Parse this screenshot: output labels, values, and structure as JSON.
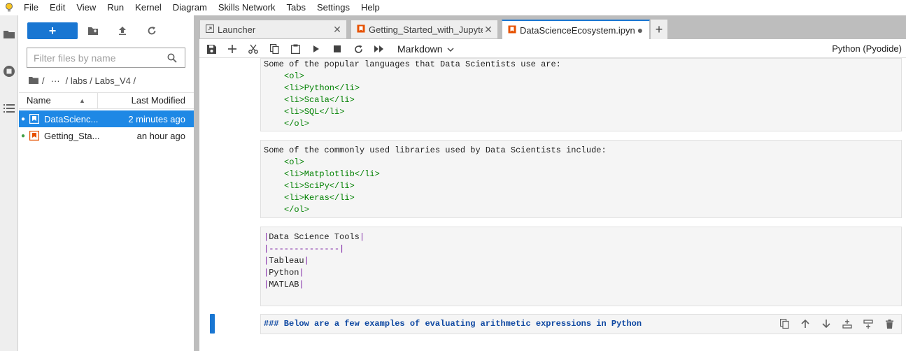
{
  "menubar": {
    "items": [
      "File",
      "Edit",
      "View",
      "Run",
      "Kernel",
      "Diagram",
      "Skills Network",
      "Tabs",
      "Settings",
      "Help"
    ]
  },
  "activitybar": {
    "icons": [
      "folder-icon",
      "running-icon",
      "toc-icon"
    ]
  },
  "filebrowser": {
    "new_label": "+",
    "filter_placeholder": "Filter files by name",
    "breadcrumb": [
      "/",
      "···",
      "/ labs / Labs_V4 /"
    ],
    "columns": {
      "name": "Name",
      "modified": "Last Modified"
    },
    "files": [
      {
        "dot": "●",
        "name": "DataScienc...",
        "modified": "2 minutes ago",
        "selected": true
      },
      {
        "dot": "●",
        "name": "Getting_Sta...",
        "modified": "an hour ago",
        "selected": false
      }
    ]
  },
  "tabs": [
    {
      "label": "Launcher",
      "close": "✕"
    },
    {
      "label": "Getting_Started_with_Jupyter",
      "close": "✕"
    },
    {
      "label": "DataScienceEcosystem.ipynb",
      "close": "●"
    }
  ],
  "add_tab": "+",
  "notebook_toolbar": {
    "cell_type": "Markdown",
    "kernel": "Python (Pyodide)"
  },
  "cells": {
    "languages": {
      "intro": "Some of the popular languages that Data Scientists use are:",
      "ol_open": "<ol>",
      "items": [
        "<li>Python</li>",
        "<li>Scala</li>",
        "<li>SQL</li>"
      ],
      "ol_close": "</ol>"
    },
    "libraries": {
      "intro": "Some of the commonly used libraries used by Data Scientists include:",
      "ol_open": "<ol>",
      "items": [
        "<li>Matplotlib</li>",
        "<li>SciPy</li>",
        "<li>Keras</li>"
      ],
      "ol_close": "</ol>"
    },
    "tools": {
      "lines": [
        "Data Science Tools",
        "--------------",
        "Tableau",
        "Python",
        "MATLAB"
      ],
      "pipe": "|"
    },
    "arithmetic": {
      "text": "### Below are a few examples of evaluating arithmetic expressions in Python"
    }
  },
  "colors": {
    "accent": "#1976d2",
    "selection": "#1e88e5",
    "tag_green": "#008000",
    "pipe_purple": "#7a1fa2",
    "heading_blue": "#0d47a1",
    "notebook_icon_orange": "#e65100"
  }
}
